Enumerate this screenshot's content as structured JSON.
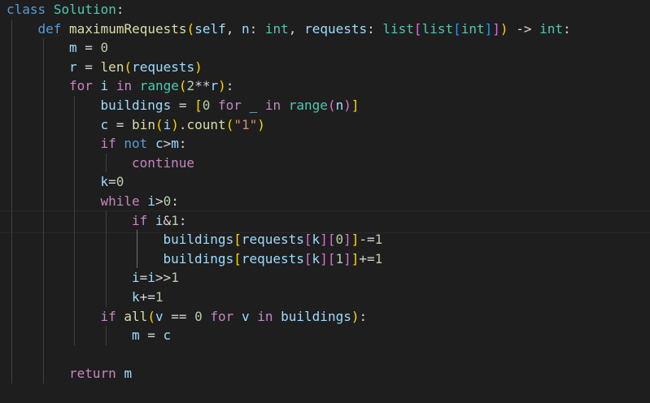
{
  "editor": {
    "language": "python",
    "theme": {
      "background": "#1e1e1e",
      "keyword": "#569cd6",
      "control": "#c586c0",
      "function": "#dcdcaa",
      "class_name": "#4ec9b0",
      "variable": "#9cdcfe",
      "number": "#b5cea8",
      "string": "#ce9178",
      "operator": "#d4d4d4",
      "bracket_1": "#ffd700",
      "bracket_2": "#da70d6",
      "bracket_3": "#179fff"
    },
    "lines": [
      {
        "indent": 0,
        "tokens": [
          [
            "class",
            "keyword"
          ],
          [
            " ",
            "plain"
          ],
          [
            "Solution",
            "class_name"
          ],
          [
            ":",
            "plain"
          ]
        ]
      },
      {
        "indent": 1,
        "tokens": [
          [
            "def",
            "keyword"
          ],
          [
            " ",
            "plain"
          ],
          [
            "maximumRequests",
            "function"
          ],
          [
            "(",
            "bracket_1"
          ],
          [
            "self",
            "variable"
          ],
          [
            ", ",
            "plain"
          ],
          [
            "n",
            "variable"
          ],
          [
            ": ",
            "plain"
          ],
          [
            "int",
            "class_name"
          ],
          [
            ", ",
            "plain"
          ],
          [
            "requests",
            "variable"
          ],
          [
            ": ",
            "plain"
          ],
          [
            "list",
            "class_name"
          ],
          [
            "[",
            "bracket_2"
          ],
          [
            "list",
            "class_name"
          ],
          [
            "[",
            "bracket_3"
          ],
          [
            "int",
            "class_name"
          ],
          [
            "]",
            "bracket_3"
          ],
          [
            "]",
            "bracket_2"
          ],
          [
            ")",
            "bracket_1"
          ],
          [
            " -> ",
            "plain"
          ],
          [
            "int",
            "class_name"
          ],
          [
            ":",
            "plain"
          ]
        ]
      },
      {
        "indent": 2,
        "tokens": [
          [
            "m",
            "variable"
          ],
          [
            " = ",
            "plain"
          ],
          [
            "0",
            "number"
          ]
        ]
      },
      {
        "indent": 2,
        "tokens": [
          [
            "r",
            "variable"
          ],
          [
            " = ",
            "plain"
          ],
          [
            "len",
            "function"
          ],
          [
            "(",
            "bracket_1"
          ],
          [
            "requests",
            "variable"
          ],
          [
            ")",
            "bracket_1"
          ]
        ]
      },
      {
        "indent": 2,
        "tokens": [
          [
            "for",
            "control"
          ],
          [
            " ",
            "plain"
          ],
          [
            "i",
            "variable"
          ],
          [
            " ",
            "plain"
          ],
          [
            "in",
            "control"
          ],
          [
            " ",
            "plain"
          ],
          [
            "range",
            "class_name"
          ],
          [
            "(",
            "bracket_1"
          ],
          [
            "2",
            "number"
          ],
          [
            "**",
            "plain"
          ],
          [
            "r",
            "variable"
          ],
          [
            ")",
            "bracket_1"
          ],
          [
            ":",
            "plain"
          ]
        ]
      },
      {
        "indent": 3,
        "tokens": [
          [
            "buildings",
            "variable"
          ],
          [
            " = ",
            "plain"
          ],
          [
            "[",
            "bracket_1"
          ],
          [
            "0",
            "number"
          ],
          [
            " ",
            "plain"
          ],
          [
            "for",
            "control"
          ],
          [
            " ",
            "plain"
          ],
          [
            "_",
            "variable"
          ],
          [
            " ",
            "plain"
          ],
          [
            "in",
            "control"
          ],
          [
            " ",
            "plain"
          ],
          [
            "range",
            "class_name"
          ],
          [
            "(",
            "bracket_2"
          ],
          [
            "n",
            "variable"
          ],
          [
            ")",
            "bracket_2"
          ],
          [
            "]",
            "bracket_1"
          ]
        ]
      },
      {
        "indent": 3,
        "tokens": [
          [
            "c",
            "variable"
          ],
          [
            " = ",
            "plain"
          ],
          [
            "bin",
            "function"
          ],
          [
            "(",
            "bracket_1"
          ],
          [
            "i",
            "variable"
          ],
          [
            ")",
            "bracket_1"
          ],
          [
            ".",
            "plain"
          ],
          [
            "count",
            "function"
          ],
          [
            "(",
            "bracket_1"
          ],
          [
            "\"1\"",
            "string"
          ],
          [
            ")",
            "bracket_1"
          ]
        ]
      },
      {
        "indent": 3,
        "tokens": [
          [
            "if",
            "control"
          ],
          [
            " ",
            "plain"
          ],
          [
            "not",
            "keyword"
          ],
          [
            " ",
            "plain"
          ],
          [
            "c",
            "variable"
          ],
          [
            ">",
            "plain"
          ],
          [
            "m",
            "variable"
          ],
          [
            ":",
            "plain"
          ]
        ]
      },
      {
        "indent": 4,
        "tokens": [
          [
            "continue",
            "control"
          ]
        ]
      },
      {
        "indent": 3,
        "tokens": [
          [
            "k",
            "variable"
          ],
          [
            "=",
            "plain"
          ],
          [
            "0",
            "number"
          ]
        ]
      },
      {
        "indent": 3,
        "tokens": [
          [
            "while",
            "control"
          ],
          [
            " ",
            "plain"
          ],
          [
            "i",
            "variable"
          ],
          [
            ">",
            "plain"
          ],
          [
            "0",
            "number"
          ],
          [
            ":",
            "plain"
          ]
        ]
      },
      {
        "indent": 4,
        "tokens": [
          [
            "if",
            "control"
          ],
          [
            " ",
            "plain"
          ],
          [
            "i",
            "variable"
          ],
          [
            "&",
            "plain"
          ],
          [
            "1",
            "number"
          ],
          [
            ":",
            "plain"
          ]
        ]
      },
      {
        "indent": 5,
        "tokens": [
          [
            "buildings",
            "variable"
          ],
          [
            "[",
            "bracket_1"
          ],
          [
            "requests",
            "variable"
          ],
          [
            "[",
            "bracket_2"
          ],
          [
            "k",
            "variable"
          ],
          [
            "]",
            "bracket_2"
          ],
          [
            "[",
            "bracket_2"
          ],
          [
            "0",
            "number"
          ],
          [
            "]",
            "bracket_2"
          ],
          [
            "]",
            "bracket_1"
          ],
          [
            "-=",
            "plain"
          ],
          [
            "1",
            "number"
          ]
        ]
      },
      {
        "indent": 5,
        "tokens": [
          [
            "buildings",
            "variable"
          ],
          [
            "[",
            "bracket_1"
          ],
          [
            "requests",
            "variable"
          ],
          [
            "[",
            "bracket_2"
          ],
          [
            "k",
            "variable"
          ],
          [
            "]",
            "bracket_2"
          ],
          [
            "[",
            "bracket_2"
          ],
          [
            "1",
            "number"
          ],
          [
            "]",
            "bracket_2"
          ],
          [
            "]",
            "bracket_1"
          ],
          [
            "+=",
            "plain"
          ],
          [
            "1",
            "number"
          ]
        ]
      },
      {
        "indent": 4,
        "tokens": [
          [
            "i",
            "variable"
          ],
          [
            "=",
            "plain"
          ],
          [
            "i",
            "variable"
          ],
          [
            ">>",
            "plain"
          ],
          [
            "1",
            "number"
          ]
        ]
      },
      {
        "indent": 4,
        "tokens": [
          [
            "k",
            "variable"
          ],
          [
            "+=",
            "plain"
          ],
          [
            "1",
            "number"
          ]
        ]
      },
      {
        "indent": 3,
        "tokens": [
          [
            "if",
            "control"
          ],
          [
            " ",
            "plain"
          ],
          [
            "all",
            "function"
          ],
          [
            "(",
            "bracket_1"
          ],
          [
            "v",
            "variable"
          ],
          [
            " == ",
            "plain"
          ],
          [
            "0",
            "number"
          ],
          [
            " ",
            "plain"
          ],
          [
            "for",
            "control"
          ],
          [
            " ",
            "plain"
          ],
          [
            "v",
            "variable"
          ],
          [
            " ",
            "plain"
          ],
          [
            "in",
            "control"
          ],
          [
            " ",
            "plain"
          ],
          [
            "buildings",
            "variable"
          ],
          [
            ")",
            "bracket_1"
          ],
          [
            ":",
            "plain"
          ]
        ]
      },
      {
        "indent": 4,
        "tokens": [
          [
            "m",
            "variable"
          ],
          [
            " = ",
            "plain"
          ],
          [
            "c",
            "variable"
          ]
        ]
      },
      {
        "indent": 0,
        "tokens": []
      },
      {
        "indent": 2,
        "tokens": [
          [
            "return",
            "control"
          ],
          [
            " ",
            "plain"
          ],
          [
            "m",
            "variable"
          ]
        ]
      }
    ]
  }
}
